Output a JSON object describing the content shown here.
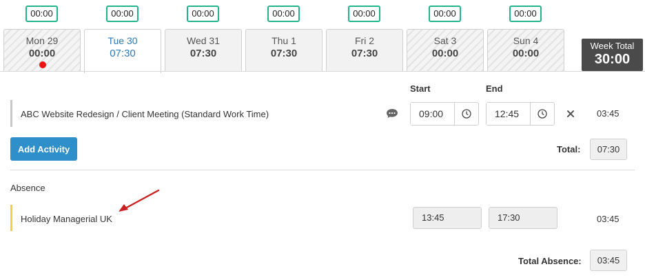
{
  "days": [
    {
      "badge": "00:00",
      "name": "Mon 29",
      "time": "00:00"
    },
    {
      "badge": "00:00",
      "name": "Tue 30",
      "time": "07:30"
    },
    {
      "badge": "00:00",
      "name": "Wed 31",
      "time": "07:30"
    },
    {
      "badge": "00:00",
      "name": "Thu 1",
      "time": "07:30"
    },
    {
      "badge": "00:00",
      "name": "Fri 2",
      "time": "07:30"
    },
    {
      "badge": "00:00",
      "name": "Sat 3",
      "time": "00:00"
    },
    {
      "badge": "00:00",
      "name": "Sun 4",
      "time": "00:00"
    }
  ],
  "week_total": {
    "label": "Week Total",
    "value": "30:00"
  },
  "columns": {
    "start": "Start",
    "end": "End"
  },
  "activity": {
    "title": "ABC Website Redesign / Client Meeting (Standard Work Time)",
    "start": "09:00",
    "end": "12:45",
    "duration": "03:45"
  },
  "add_activity_label": "Add Activity",
  "total": {
    "label": "Total:",
    "value": "07:30"
  },
  "absence": {
    "heading": "Absence",
    "title": "Holiday Managerial UK",
    "start": "13:45",
    "end": "17:30",
    "duration": "03:45"
  },
  "total_absence": {
    "label": "Total Absence:",
    "value": "03:45"
  },
  "colors": {
    "accent": "#2f8fcb",
    "badge_border": "#22b38a",
    "absence_bar": "#f2d43a",
    "alert_dot": "#ee1111",
    "arrow": "#cc1f1f"
  }
}
